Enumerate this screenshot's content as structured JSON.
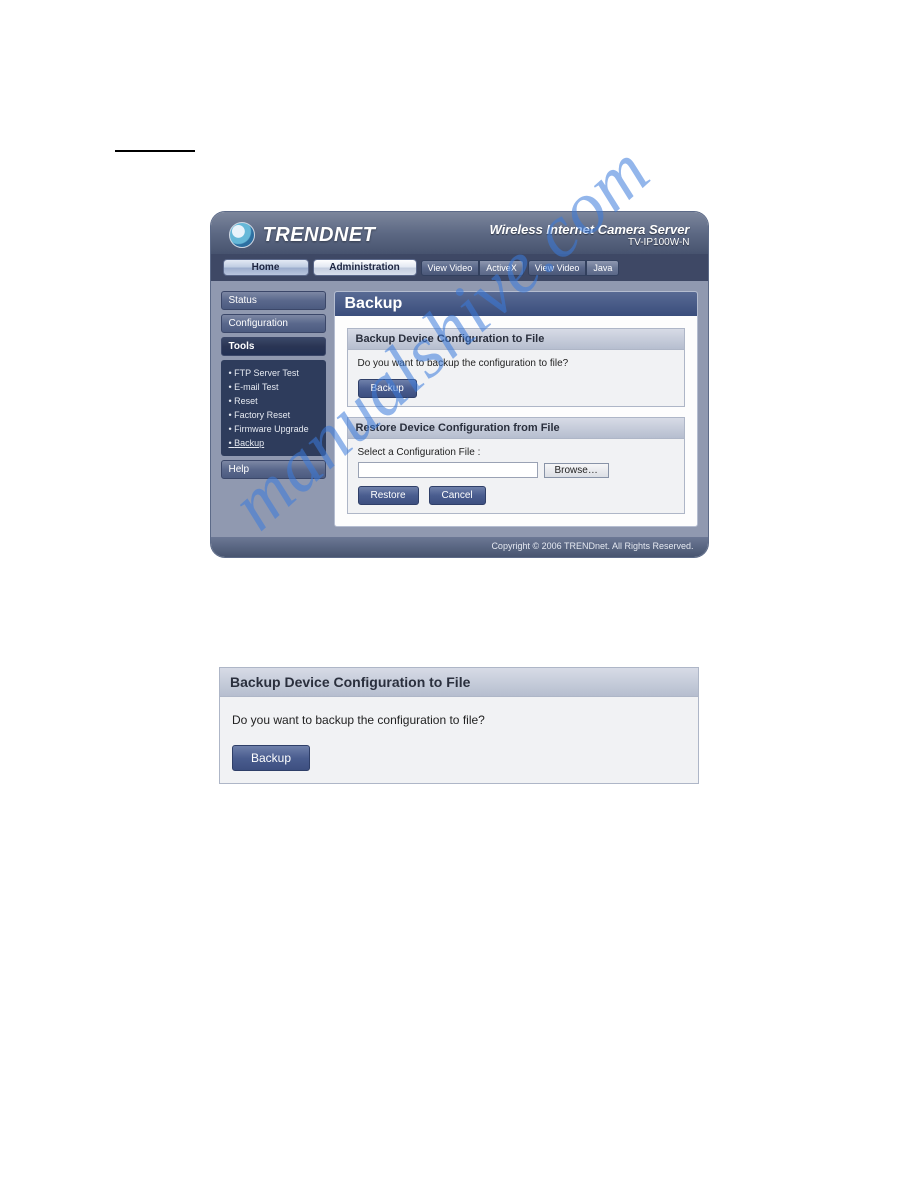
{
  "watermark": "manualshive.com",
  "logo_text": "TRENDNET",
  "header": {
    "title": "Wireless Internet Camera Server",
    "subtitle": "TV-IP100W-N"
  },
  "topnav": {
    "home": "Home",
    "admin": "Administration",
    "view1": "View Video",
    "activex": "ActiveX",
    "view2": "View Video",
    "java": "Java"
  },
  "sidebar": {
    "status": "Status",
    "config": "Configuration",
    "tools": "Tools",
    "items": [
      {
        "label": "FTP Server Test"
      },
      {
        "label": "E-mail Test"
      },
      {
        "label": "Reset"
      },
      {
        "label": "Factory Reset"
      },
      {
        "label": "Firmware Upgrade"
      },
      {
        "label": "Backup"
      }
    ],
    "help": "Help"
  },
  "content": {
    "title": "Backup",
    "block1": {
      "head": "Backup Device Configuration to File",
      "prompt": "Do you want to backup the configuration to file?",
      "btn": "Backup"
    },
    "block2": {
      "head": "Restore Device Configuration from File",
      "label": "Select a Configuration File :",
      "browse": "Browse…",
      "restore": "Restore",
      "cancel": "Cancel"
    }
  },
  "footer": "Copyright © 2006 TRENDnet. All Rights Reserved.",
  "detached": {
    "head": "Backup Device Configuration to File",
    "prompt": "Do you want to backup the configuration to file?",
    "btn": "Backup"
  }
}
